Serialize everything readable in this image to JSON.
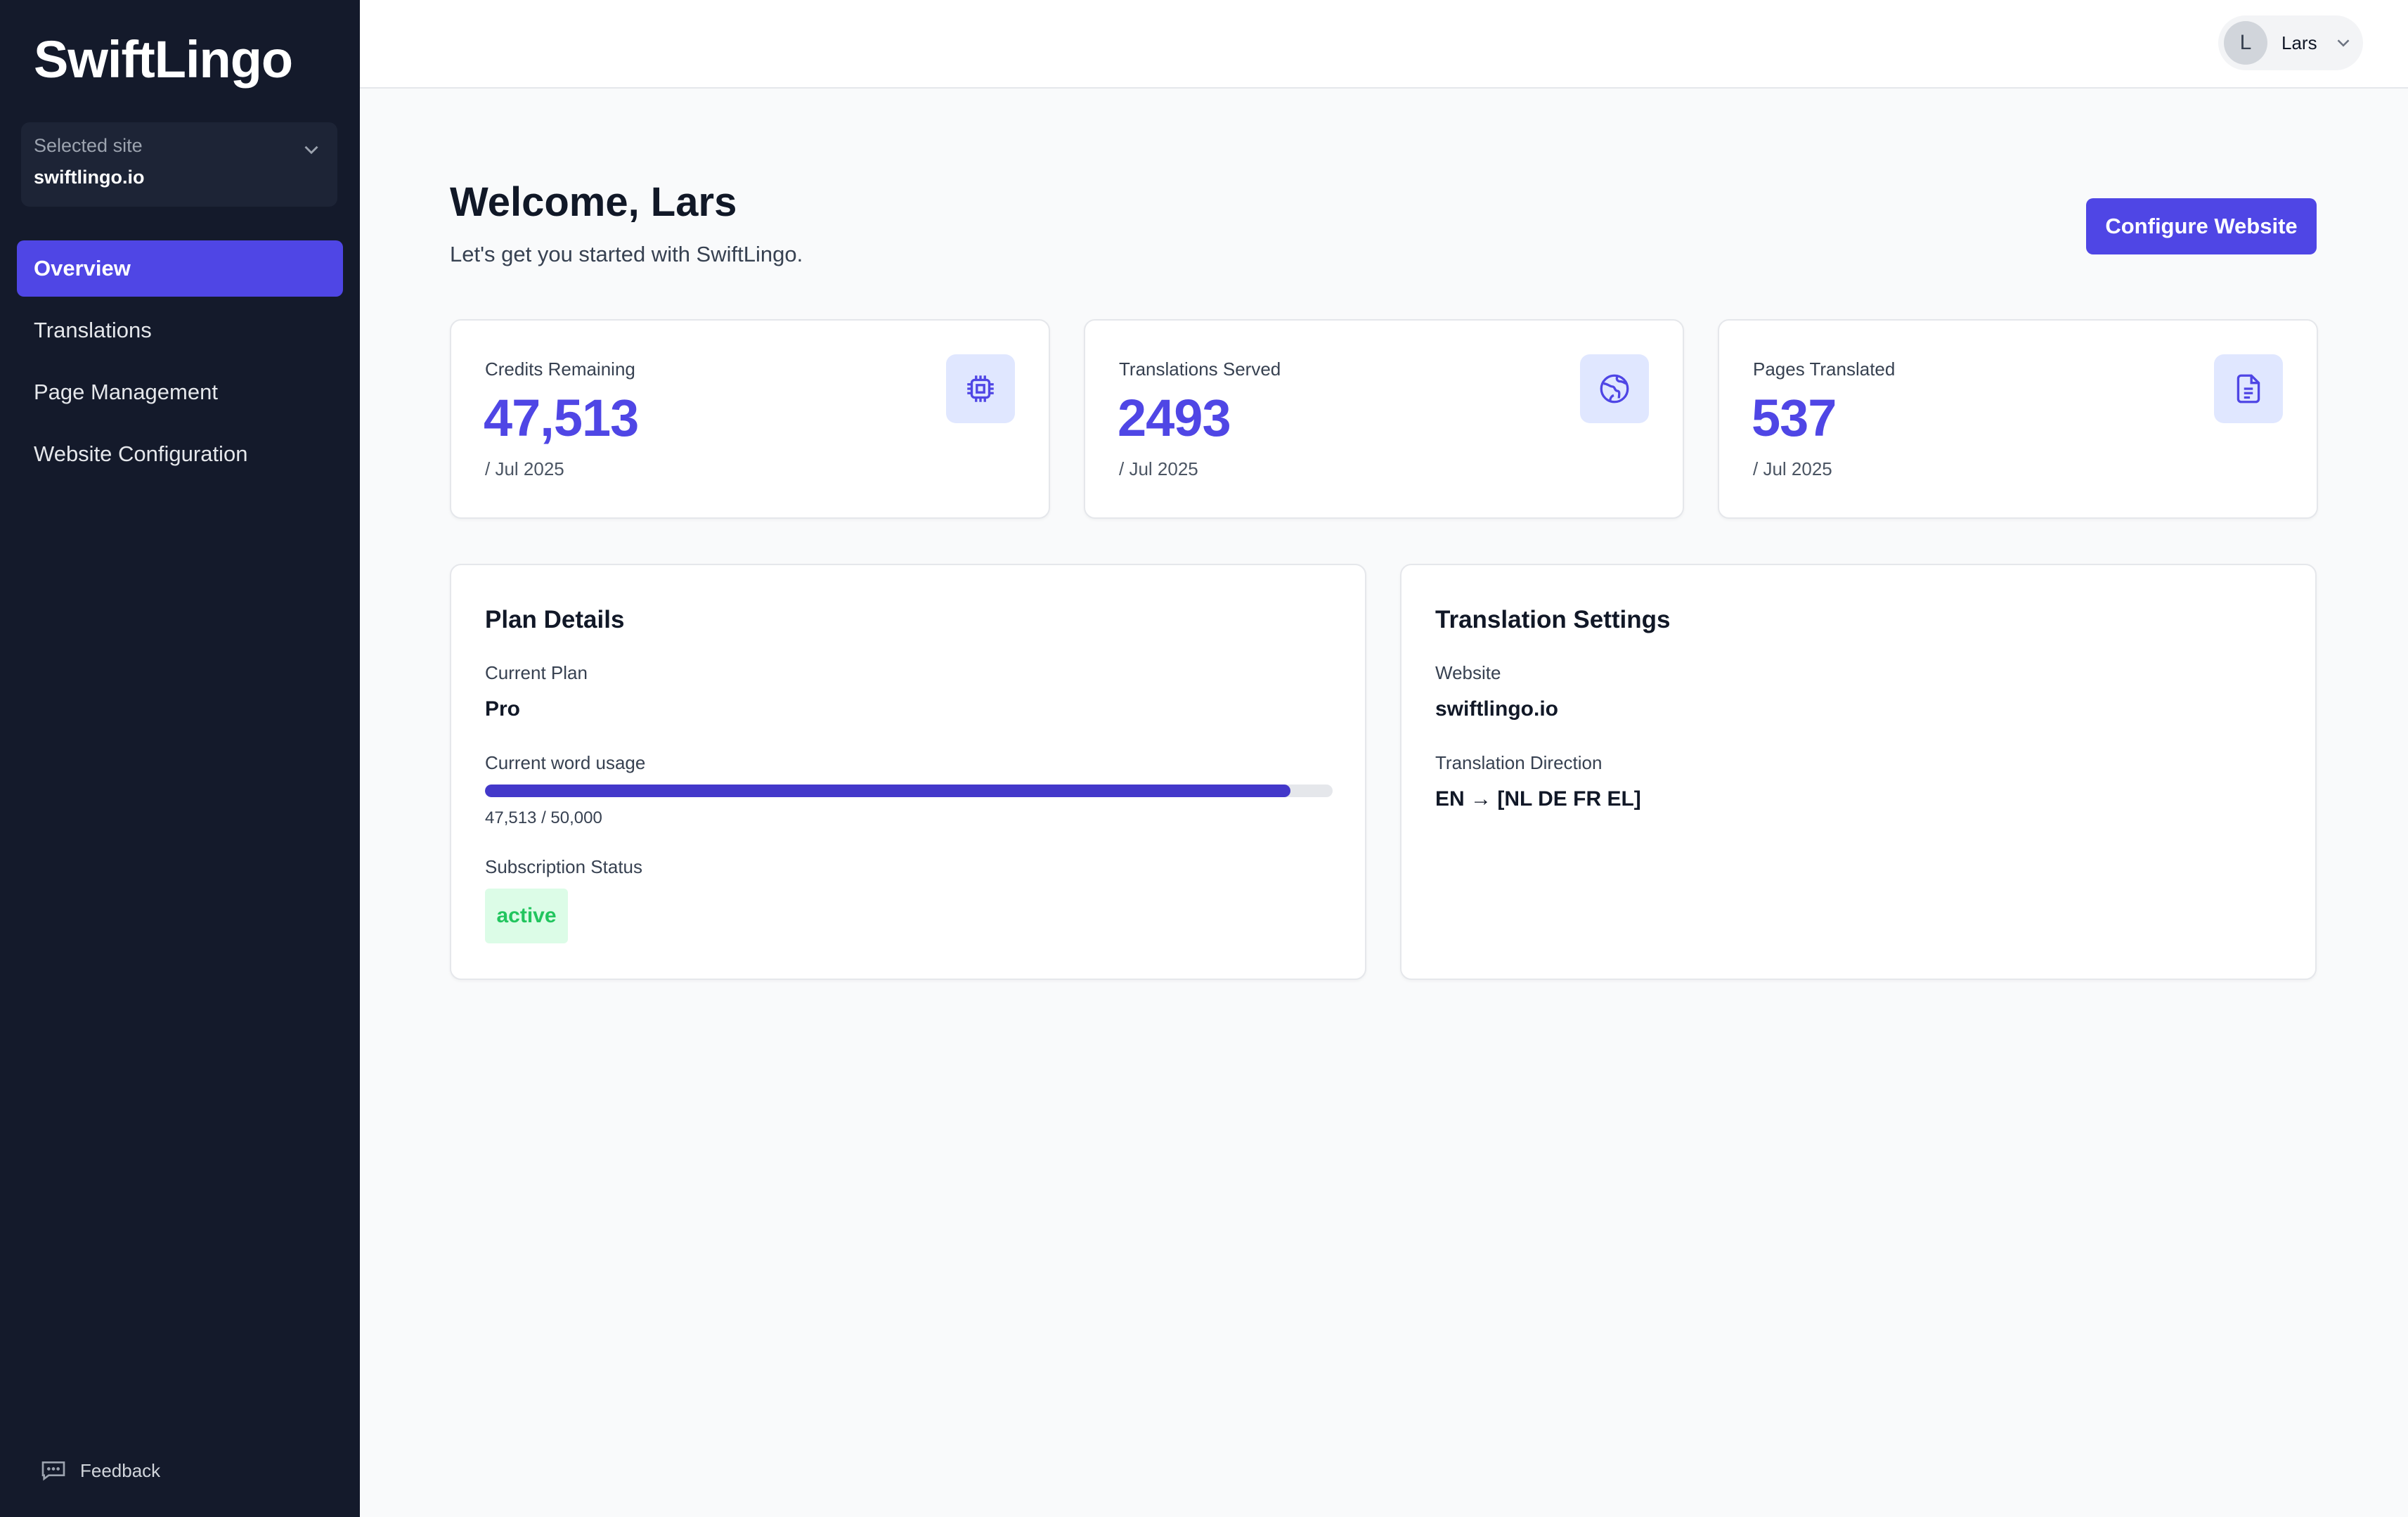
{
  "brand": {
    "name": "SwiftLingo",
    "accent_color": "#4f46e5"
  },
  "site_selector": {
    "label": "Selected site",
    "value": "swiftlingo.io",
    "icon": "chevron-down-icon"
  },
  "sidebar": {
    "items": [
      {
        "label": "Overview",
        "active": true
      },
      {
        "label": "Translations",
        "active": false
      },
      {
        "label": "Page Management",
        "active": false
      },
      {
        "label": "Website Configuration",
        "active": false
      }
    ],
    "feedback": {
      "label": "Feedback",
      "icon": "chat-icon"
    }
  },
  "header": {
    "user": {
      "initial": "L",
      "name": "Lars"
    }
  },
  "page": {
    "title": "Welcome, Lars",
    "subtitle": "Let's get you started with SwiftLingo.",
    "configure_button": "Configure Website"
  },
  "stats": [
    {
      "label": "Credits Remaining",
      "value": "47,513",
      "period": "/ Jul 2025",
      "icon": "cpu-chip-icon"
    },
    {
      "label": "Translations Served",
      "value": "2493",
      "period": "/ Jul 2025",
      "icon": "globe-icon"
    },
    {
      "label": "Pages Translated",
      "value": "537",
      "period": "/ Jul 2025",
      "icon": "document-icon"
    }
  ],
  "plan_details": {
    "title": "Plan Details",
    "current_plan_label": "Current Plan",
    "current_plan": "Pro",
    "word_usage_label": "Current word usage",
    "word_usage_text": "47,513 / 50,000",
    "word_usage_fraction": 0.95,
    "subscription_label": "Subscription Status",
    "subscription_status": "active",
    "status_color": "#22c55e"
  },
  "translation_settings": {
    "title": "Translation Settings",
    "website_label": "Website",
    "website": "swiftlingo.io",
    "direction_label": "Translation Direction",
    "direction": "EN → [NL DE FR EL]"
  }
}
